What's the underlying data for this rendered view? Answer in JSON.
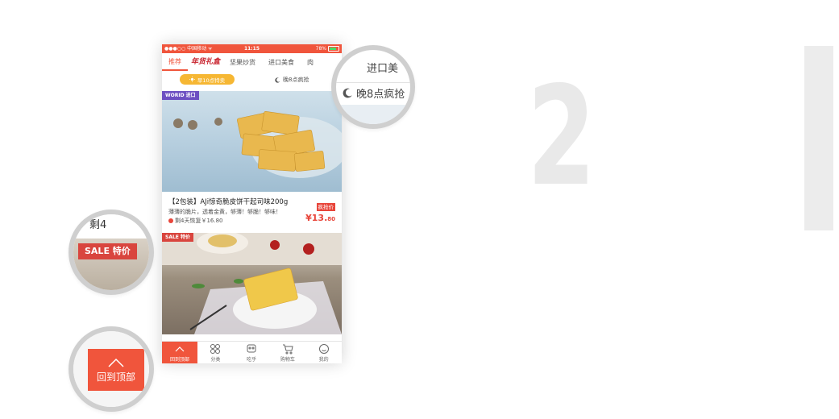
{
  "status_bar": {
    "carrier": "●●●○○ 中国移动 ᯤ",
    "time": "11:15",
    "battery": "78%"
  },
  "tabs": [
    {
      "label": "推荐",
      "active": true
    },
    {
      "label": "年货礼盒",
      "brand": true
    },
    {
      "label": "坚果炒货"
    },
    {
      "label": "进口美食"
    },
    {
      "label": "肉"
    }
  ],
  "time_bar": {
    "morning": "早10点特卖",
    "night": "晚8点疯抢"
  },
  "products": [
    {
      "badge": "WORID 进口",
      "title": "【2包装】AJi惊奇脆皮饼干起司味200g",
      "desc": "薄薄的脆片，透着金黄，够薄！够脆！够味！",
      "remain": "剩4天恢复￥16.80",
      "rush_label": "疯抢价",
      "price_main": "¥13.",
      "price_cents": "80"
    },
    {
      "badge": "SALE 特价"
    }
  ],
  "bottom_nav": [
    {
      "label": "回到顶部",
      "icon": "chevron-up-icon"
    },
    {
      "label": "分类",
      "icon": "grid-icon"
    },
    {
      "label": "吃乎",
      "icon": "chat-icon"
    },
    {
      "label": "购物车",
      "icon": "cart-icon"
    },
    {
      "label": "我的",
      "icon": "profile-icon"
    }
  ],
  "callouts": {
    "night_tab_text": "进口美",
    "night_text": "晚8点疯抢",
    "sale_above_text": "剩4",
    "sale_label": "SALE 特价",
    "back_top_text": "回到顶部"
  },
  "big_number": "2",
  "colors": {
    "accent": "#f0553c",
    "price": "#e8453a",
    "world_badge": "#6d4fc2",
    "morning_pill": "#f6b733"
  }
}
